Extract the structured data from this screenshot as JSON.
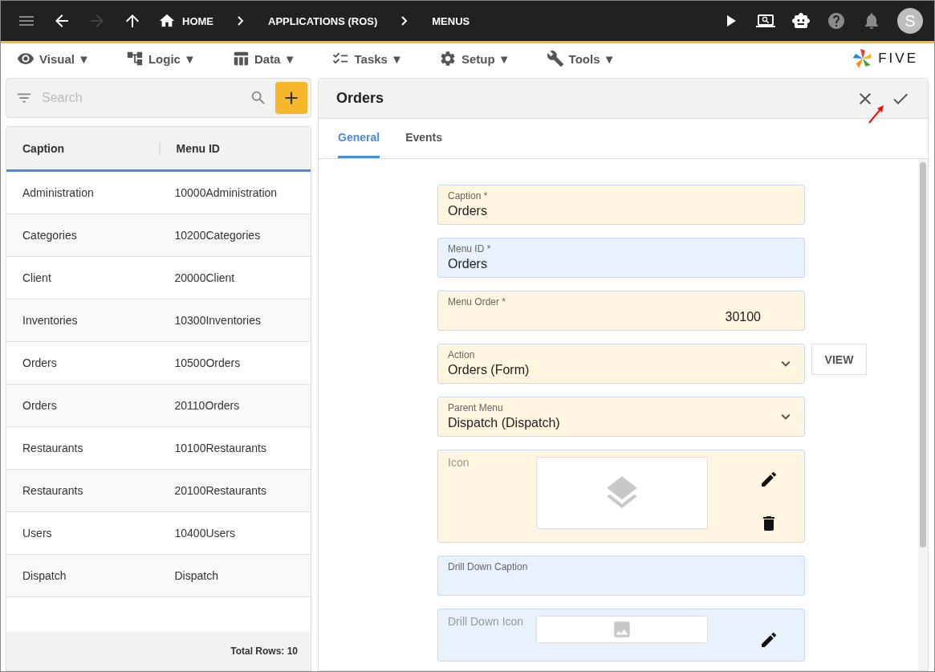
{
  "topbar": {
    "nav": [
      {
        "kind": "menu",
        "disabled": false
      },
      {
        "kind": "back",
        "disabled": false
      },
      {
        "kind": "forward",
        "disabled": true
      },
      {
        "kind": "up",
        "disabled": false
      }
    ],
    "breadcrumbs": [
      "HOME",
      "APPLICATIONS (ROS)",
      "MENUS"
    ],
    "actions": [
      {
        "kind": "play"
      },
      {
        "kind": "inspect"
      },
      {
        "kind": "chat"
      },
      {
        "kind": "help"
      },
      {
        "kind": "bell"
      }
    ],
    "avatar": "S"
  },
  "menubar": {
    "items": [
      {
        "kind": "visual",
        "label": "Visual ▼"
      },
      {
        "kind": "logic",
        "label": "Logic ▼"
      },
      {
        "kind": "data",
        "label": "Data ▼"
      },
      {
        "kind": "tasks",
        "label": "Tasks ▼"
      },
      {
        "kind": "setup",
        "label": "Setup ▼"
      },
      {
        "kind": "tools",
        "label": "Tools ▼"
      }
    ],
    "logo": "FIVE"
  },
  "list": {
    "search": {
      "placeholder": "Search"
    },
    "columns": [
      "Caption",
      "Menu ID"
    ],
    "rows": [
      [
        "Administration",
        "10000Administration"
      ],
      [
        "Categories",
        "10200Categories"
      ],
      [
        "Client",
        "20000Client"
      ],
      [
        "Inventories",
        "10300Inventories"
      ],
      [
        "Orders",
        "10500Orders"
      ],
      [
        "Orders",
        "20110Orders"
      ],
      [
        "Restaurants",
        "10100Restaurants"
      ],
      [
        "Restaurants",
        "20100Restaurants"
      ],
      [
        "Users",
        "10400Users"
      ],
      [
        "Dispatch",
        "Dispatch"
      ]
    ],
    "footer": "Total Rows: 10"
  },
  "form": {
    "title": "Orders",
    "tabs": [
      {
        "label": "General",
        "selected": true
      },
      {
        "label": "Events",
        "selected": false
      }
    ],
    "fields": [
      {
        "kind": "text",
        "label": "Caption *",
        "value": "Orders",
        "color": "#fff5e1"
      },
      {
        "kind": "text",
        "label": "Menu ID *",
        "value": "Orders",
        "color": "#e8f1fc"
      },
      {
        "kind": "number",
        "label": "Menu Order *",
        "value": "30100",
        "color": "#fff5e1"
      },
      {
        "kind": "select",
        "label": "Action",
        "value": "Orders (Form)",
        "color": "#fff5e1",
        "button": "VIEW"
      },
      {
        "kind": "select",
        "label": "Parent Menu",
        "value": "Dispatch (Dispatch)",
        "color": "#fff5e1"
      },
      {
        "kind": "image",
        "label": "Icon",
        "color": "#fff5e1"
      },
      {
        "kind": "text",
        "label": "Drill Down Caption",
        "color": "#e8f1fc"
      },
      {
        "kind": "image_small",
        "label": "Drill Down Icon",
        "color": "#e8f1fc"
      }
    ]
  }
}
